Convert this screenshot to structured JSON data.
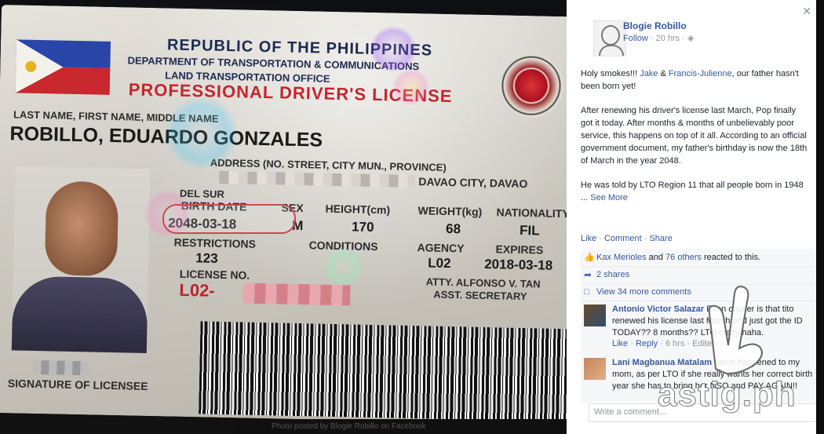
{
  "license": {
    "republic": "REPUBLIC OF THE PHILIPPINES",
    "department": "DEPARTMENT OF TRANSPORTATION & COMMUNICATIONS",
    "office": "LAND TRANSPORTATION OFFICE",
    "title": "PROFESSIONAL DRIVER'S LICENSE",
    "name_header": "LAST NAME, FIRST NAME, MIDDLE NAME",
    "name": "ROBILLO, EDUARDO GONZALES",
    "address_header": "ADDRESS (NO. STREET, CITY MUN., PROVINCE)",
    "address_tail": "DAVAO CITY, DAVAO",
    "address_line2": "DEL SUR",
    "fields": {
      "birth_date_label": "BIRTH DATE",
      "birth_date": "2048-03-18",
      "sex_label": "SEX",
      "sex": "M",
      "height_label": "HEIGHT(cm)",
      "height": "170",
      "weight_label": "WEIGHT(kg)",
      "weight": "68",
      "nationality_label": "NATIONALITY",
      "nationality": "FIL",
      "restrictions_label": "RESTRICTIONS",
      "restrictions": "123",
      "conditions_label": "CONDITIONS",
      "agency_label": "AGENCY",
      "agency": "L02",
      "expires_label": "EXPIRES",
      "expires": "2018-03-18",
      "license_no_label": "LICENSE NO.",
      "license_no": "L02-"
    },
    "signatory": "ATTY. ALFONSO V. TAN",
    "signatory_title": "ASST. SECRETARY",
    "signature_label": "SIGNATURE OF LICENSEE"
  },
  "fb": {
    "close_glyph": "✕",
    "author": "Blogie Robillo",
    "follow": "Follow",
    "time": "20 hrs",
    "post": {
      "p1_a": "Holy smokes!!! ",
      "p1_link1": "Jake",
      "p1_b": " & ",
      "p1_link2": "Francis-Julienne",
      "p1_c": ", our father hasn't been born yet!",
      "p2": "After renewing his driver's license last March, Pop finally got it today. After months & months of unbelievably poor service, this happens on top of it all. According to an official government document, my father's birthday is now the 18th of March in the year 2048.",
      "p3": "He was told by LTO Region 11 that all people born in 1948 ... ",
      "see_more": "See More"
    },
    "actions": {
      "like": "Like",
      "comment": "Comment",
      "share": "Share"
    },
    "reactions": {
      "name": "Kax Merioles",
      "and": " and ",
      "others": "76 others",
      "tail": " reacted to this."
    },
    "shares": "2 shares",
    "more_comments": "View 34 more comments",
    "comments": [
      {
        "name": "Antonio Victor Salazar",
        "text": " Even crazier is that tito renewed his license last March and just got the ID TODAY?? 8 months?? LTO crazy haha.",
        "like": "Like",
        "reply": "Reply",
        "time": "6 hrs",
        "edited": "Edited"
      },
      {
        "name": "Lani Magbanua Matalam",
        "text": " same happened to my mom, as per LTO if she really wants her correct birth year she has to bring her NSO and PAY AGAIN!!"
      }
    ],
    "write_placeholder": "Write a comment..."
  },
  "watermark": "astig.ph",
  "bottom_text": "Photo posted by Blogie Robillo on Facebook"
}
